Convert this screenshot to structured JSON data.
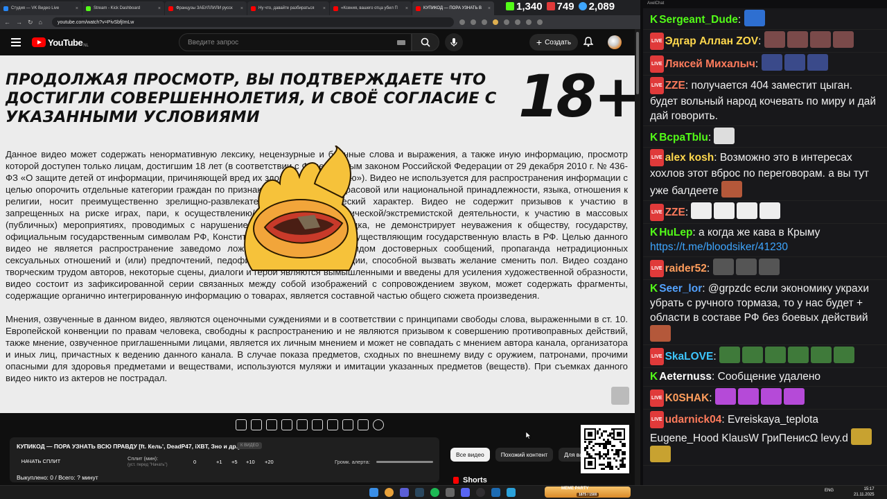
{
  "browser": {
    "tabs": [
      {
        "label": "Студия — VK Видео Live",
        "color": "#2787f5",
        "active": false
      },
      {
        "label": "Stream - Kick Dashboard",
        "color": "#53fc18",
        "active": false
      },
      {
        "label": "Французы ЗАБУЛЛИЛИ русск",
        "color": "#ff0000",
        "active": false
      },
      {
        "label": "Ну что, давайте разбираться",
        "color": "#ff0000",
        "active": false
      },
      {
        "label": "«Ксения, вашего отца убил П",
        "color": "#ff0000",
        "active": false
      },
      {
        "label": "КУПИКОД — ПОРА УЗНАТЬ В",
        "color": "#ff0000",
        "active": true
      }
    ],
    "url": "youtube.com/watch?v=PivSbfjImLw"
  },
  "stats": {
    "kick": "1,340",
    "vk": "749",
    "viewers": "2,089"
  },
  "youtube": {
    "logo": "YouTube",
    "region": "NL",
    "search_placeholder": "Введите запрос",
    "create_label": "Создать"
  },
  "video": {
    "headline": "Продолжая просмотр, вы подтверждаете что достигли совершеннолетия, и своё согласие с указанными условиями",
    "age": "18+",
    "paragraph1": "Данное видео может содержать ненормативную лексику, нецензурные и бранные слова и выражения, а также иную информацию, просмотр которой доступен только лицам, достигшим 18 лет (в соответствии с Федеральным законом Российской Федерации от 29 декабря 2010 г. № 436-ФЗ «О защите детей от информации, причиняющей вред их здоровью и развитию»). Видео не используется для распространения информации с целью опорочить отдельные категории граждан по признакам пола, возраста, расовой или национальной принадлежности, языка, отношения к религии, носит преимущественно зрелищно-развлекательный, юмористический характер. Видео не содержит призывов к участию в запрещенных на риске играх, пари, к осуществлению/поддержке террористической/экстремистской деятельности, к участию в массовых (публичных) мероприятиях, проводимых с нарушением установленного порядка, не демонстрирует неуважения к обществу, государству, официальным государственным символам РФ, Конституции РФ или органам, осуществляющим государственную власть в РФ. Целью данного видео не является распространение заведомо ложной информации под видом достоверных сообщений, пропаганда нетрадиционных сексуальных отношений и (или) предпочтений, педофилии, а также информации, способной вызвать желание сменить пол. Видео создано творческим трудом авторов, некоторые сцены, диалоги и герои являются вымышленными и введены для усиления художественной образности, видео состоит из зафиксированной серии связанных между собой изображений с сопровождением звуком, может содержать фрагменты, содержащие органично интегрированную информацию о товарах, является составной частью общего сюжета произведения.",
    "paragraph2": "Мнения, озвученные в данном видео, являются оценочными суждениями и в соответствии с принципами свободы слова, выраженными в ст. 10. Европейской конвенции по правам человека, свободны к распространению и не являются призывом к совершению противоправных действий, также мнение, озвученное приглашенными лицами, является их личным мнением и может не совпадать с мнением автора канала, организатора и иных лиц, причастных к ведению данного канала. В случае показа предметов, сходных по внешнему виду с оружием, патронами, прочими опасными для здоровья предметами и веществами, используются муляжи и имитации указанных предметов (веществ). При съемках данного видео никто из актеров не пострадал."
  },
  "panel": {
    "title": "КУПИКОД — ПОРА УЗНАТЬ ВСЮ ПРАВДУ [ft. Кель', DeadP47, iXBT, Зно и др.]",
    "badge": "К ВИДЕО",
    "split_button": "НАЧАТЬ СПЛИТ",
    "split_label": "Сплит (мин):",
    "split_hint": "(уст. перед \"Начать\")",
    "split_value": "0",
    "increments": [
      "+1",
      "+5",
      "+10",
      "+20"
    ],
    "alert_label": "Громк. алерта:",
    "footer": "Выкуплено: 0 / Всего: ? минут"
  },
  "chips": [
    "Все видео",
    "Похожий контент",
    "Для ва"
  ],
  "shorts_label": "Shorts",
  "chat": {
    "header": "AxelChat",
    "messages": [
      {
        "platform": "kick",
        "user": "Sergeant_Dude",
        "color": "#53fc18",
        "text": "",
        "emotes": 1,
        "emote_color": "#2e6fd1"
      },
      {
        "platform": "vk",
        "user": "Эдгар Аллан ZOV",
        "color": "#ffd84d",
        "text": "",
        "emotes": 4,
        "emote_color": "#7a4a4a"
      },
      {
        "platform": "vk",
        "user": "Ляксей Михалыч",
        "color": "#ff7b5c",
        "text": "",
        "emotes": 3,
        "emote_color": "#3a4a8a"
      },
      {
        "platform": "vk",
        "user": "ZZE",
        "color": "#ff7b5c",
        "text": "получается 404 заместит цыган. будет вольный народ кочевать по миру и дай дай говорить.",
        "emotes": 0,
        "emote_color": ""
      },
      {
        "platform": "kick",
        "user": "BcpaTblu",
        "color": "#53fc18",
        "text": "",
        "emotes": 1,
        "emote_color": "#dddddd"
      },
      {
        "platform": "vk",
        "user": "alex kosh",
        "color": "#ffd84d",
        "text": "Возможно это в интересах хохлов этот вброс по переговорам. а вы тут уже балдеете",
        "emotes": 1,
        "emote_color": "#b4583a"
      },
      {
        "platform": "vk",
        "user": "ZZE",
        "color": "#ff7b5c",
        "text": "",
        "emotes": 4,
        "emote_color": "#eeeeee"
      },
      {
        "platform": "kick",
        "user": "HuLep",
        "color": "#53fc18",
        "text": "а когда же кава в Крыму",
        "emotes": 0,
        "emote_color": "",
        "link": "https://t.me/bloodsiker/41230"
      },
      {
        "platform": "vk",
        "user": "raider52",
        "color": "#ff9d5c",
        "text": "",
        "emotes": 3,
        "emote_color": "#555555"
      },
      {
        "platform": "kick",
        "user": "Seer_lor",
        "color": "#53a2ff",
        "text": "@grpzdc если экономику украхи убрать с ручного тормаза, то у нас будет + области в составе РФ без боевых действий",
        "emotes": 1,
        "emote_color": "#b4583a"
      },
      {
        "platform": "vk",
        "user": "SkaLOVE",
        "color": "#3ec6ff",
        "text": "",
        "emotes": 6,
        "emote_color": "#3f7a3a"
      },
      {
        "platform": "kick",
        "user": "Aeternuss",
        "color": "#ffffff",
        "text": "Сообщение удалено",
        "emotes": 0,
        "emote_color": ""
      },
      {
        "platform": "vk",
        "user": "K0SHAK",
        "color": "#ff9d5c",
        "text": "",
        "emotes": 4,
        "emote_color": "#b54ad8"
      },
      {
        "platform": "vk",
        "user": "udarnick04",
        "color": "#ff7b5c",
        "text": "Evreiskaya_teplota Eugene_Hood KlausW ГриПенисΩ levy.d",
        "emotes": 2,
        "emote_color": "#c8a230"
      }
    ]
  },
  "taskbar": {
    "meme_label": "MEME PARTY",
    "meme_counter": "1875 / 1500",
    "lang": "ENG",
    "time": "15:17",
    "date": "21.11.2025"
  }
}
